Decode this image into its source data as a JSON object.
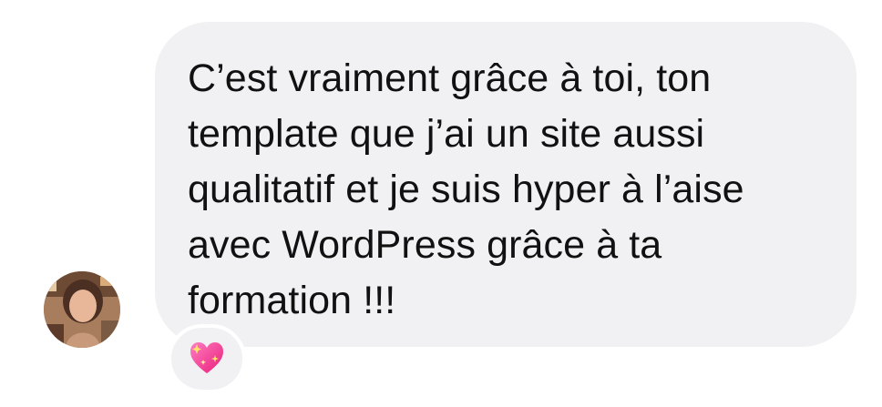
{
  "message": {
    "text": "C’est vraiment grâce à toi, ton template que j’ai un site aussi qualitatif et je suis hyper à l’aise avec WordPress grâce à ta formation !!!",
    "bubble_color": "#f1f1f3",
    "text_color": "#111111"
  },
  "sender": {
    "avatar_icon": "profile-photo"
  },
  "reaction": {
    "icon": "sparkling-heart-icon",
    "color": "#ff4fa3"
  }
}
